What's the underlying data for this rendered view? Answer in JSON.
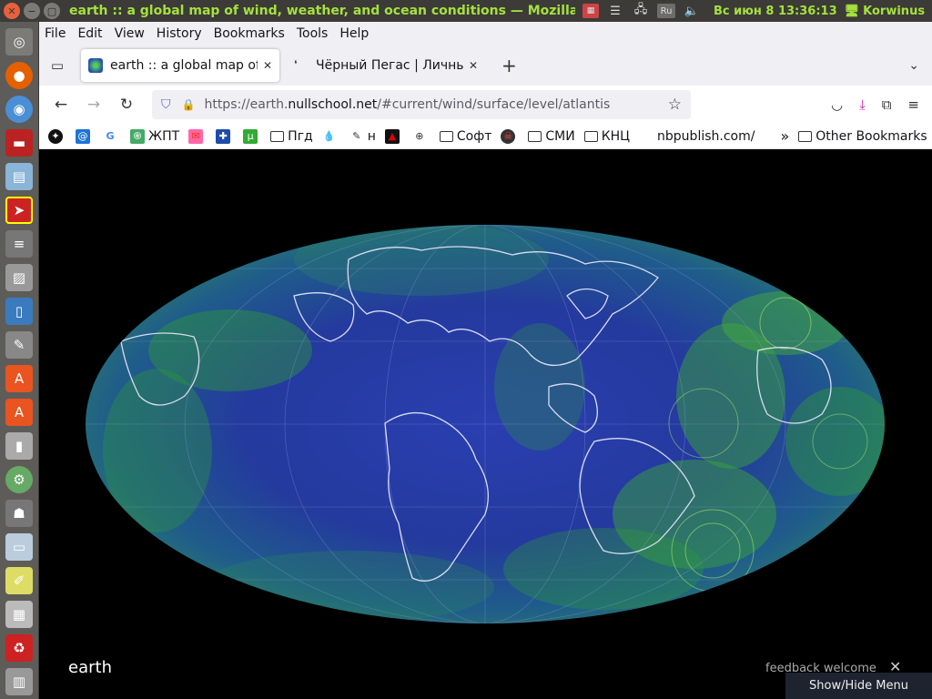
{
  "window": {
    "title": "earth :: a global map of wind, weather, and ocean conditions — Mozilla Firefox"
  },
  "system": {
    "keyboard_layout": "Ru",
    "clock": "Вс июн  8 13:36:13",
    "user": "Korwinus"
  },
  "menu": [
    "File",
    "Edit",
    "View",
    "History",
    "Bookmarks",
    "Tools",
    "Help"
  ],
  "tabs": [
    {
      "title": "earth :: a global map of wind",
      "active": true
    },
    {
      "title": "Чёрный Пегас | Личный",
      "active": false
    }
  ],
  "url": {
    "prefix": "https://earth.",
    "domain": "nullschool.net",
    "path": "/#current/wind/surface/level/atlantis"
  },
  "bookmarks": [
    {
      "label": "",
      "icon": "star-dark-icon"
    },
    {
      "label": "",
      "icon": "at-icon"
    },
    {
      "label": "",
      "icon": "google-icon"
    },
    {
      "label": "ЖПТ",
      "icon": "chatgpt-icon"
    },
    {
      "label": "",
      "icon": "mail-icon"
    },
    {
      "label": "",
      "icon": "plus-icon"
    },
    {
      "label": "",
      "icon": "utorrent-icon"
    },
    {
      "label": "Пгд",
      "icon": "folder-icon"
    },
    {
      "label": "",
      "icon": "drop-icon"
    },
    {
      "label": "н",
      "icon": "edit-icon"
    },
    {
      "label": "",
      "icon": "red-triangle-icon"
    },
    {
      "label": "",
      "icon": "globe-icon"
    },
    {
      "label": "Софт",
      "icon": "folder-icon"
    },
    {
      "label": "",
      "icon": "pirate-icon"
    },
    {
      "label": "СМИ",
      "icon": "folder-icon"
    },
    {
      "label": "КНЦ",
      "icon": "folder-icon"
    },
    {
      "label": "nbpublish.com/",
      "icon": ""
    }
  ],
  "bookmarks_overflow": "»",
  "other_bookmarks": "Other Bookmarks",
  "page": {
    "brand": "earth",
    "feedback": "feedback welcome",
    "close": "✕",
    "show_hide_menu": "Show/Hide Menu"
  },
  "colors": {
    "title_green": "#a5e13d",
    "ocean_blue": "#2438a0",
    "wind_green": "#2f9a3a"
  }
}
